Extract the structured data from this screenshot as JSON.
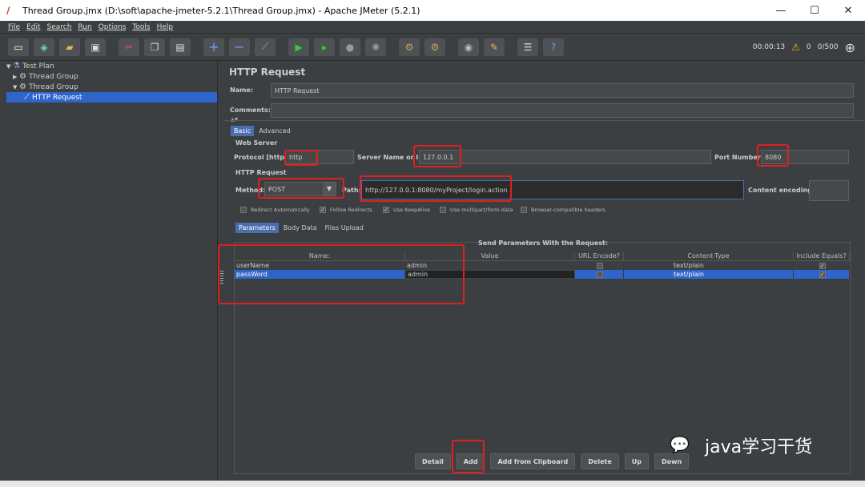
{
  "window": {
    "title": "Thread Group.jmx (D:\\soft\\apache-jmeter-5.2.1\\Thread Group.jmx) - Apache JMeter (5.2.1)",
    "min": "—",
    "max": "☐",
    "close": "✕"
  },
  "menu": [
    "File",
    "Edit",
    "Search",
    "Run",
    "Options",
    "Tools",
    "Help"
  ],
  "toolbar": {
    "timer": "00:00:13",
    "warnings": "0",
    "threads": "0/500",
    "icons": [
      "new-icon",
      "templates-icon",
      "open-icon",
      "save-icon",
      "cut-icon",
      "copy-icon",
      "paste-icon",
      "expand-icon",
      "collapse-icon",
      "toggle-icon",
      "start-icon",
      "start-no-pause-icon",
      "stop-icon",
      "shutdown-icon",
      "clear-icon",
      "clear-all-icon",
      "search-icon",
      "reset-search-icon",
      "function-helper-icon",
      "help-icon"
    ]
  },
  "tree": [
    {
      "label": "Test Plan"
    },
    {
      "label": "Thread Group"
    },
    {
      "label": "Thread Group"
    },
    {
      "label": "HTTP Request"
    }
  ],
  "panel": {
    "header": "HTTP Request",
    "name_label": "Name:",
    "name_value": "HTTP Request",
    "comments_label": "Comments:",
    "tabs": [
      "Basic",
      "Advanced"
    ],
    "web_server_label": "Web Server",
    "protocol_label": "Protocol [http]:",
    "protocol_value": "http",
    "server_label": "Server Name or IP:",
    "server_value": "127.0.0.1",
    "port_label": "Port Number:",
    "port_value": "8080",
    "http_request_label": "HTTP Request",
    "method_label": "Method:",
    "method_value": "POST",
    "path_label": "Path:",
    "path_value": "http://127.0.0.1:8080/myProject/login.action",
    "encoding_label": "Content encoding:",
    "checkboxes": [
      {
        "label": "Redirect Automatically",
        "checked": false
      },
      {
        "label": "Follow Redirects",
        "checked": true
      },
      {
        "label": "Use KeepAlive",
        "checked": true
      },
      {
        "label": "Use multipart/form-data",
        "checked": false
      },
      {
        "label": "Browser-compatible headers",
        "checked": false
      }
    ],
    "subtabs": [
      "Parameters",
      "Body Data",
      "Files Upload"
    ],
    "params_title": "Send Parameters With the Request:",
    "columns": [
      "Name:",
      "Value",
      "URL Encode?",
      "Content-Type",
      "Include Equals?"
    ],
    "rows": [
      {
        "name": "userName",
        "value": "admin",
        "url_encode": false,
        "content_type": "text/plain",
        "include_equals": true
      },
      {
        "name": "passWord",
        "value": "admin",
        "url_encode": false,
        "content_type": "text/plain",
        "include_equals": true
      }
    ],
    "buttons": [
      "Detail",
      "Add",
      "Add from Clipboard",
      "Delete",
      "Up",
      "Down"
    ]
  },
  "watermark": "java学习干货",
  "colors": {
    "background": "#3c3f41",
    "selection": "#2f65ca",
    "highlight": "#e0201f"
  }
}
